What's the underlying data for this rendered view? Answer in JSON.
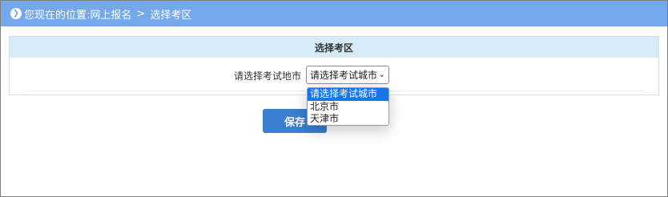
{
  "breadcrumb": {
    "icon": "chevron-right-circle-icon",
    "prefix": "您现在的位置:",
    "item1": "网上报名",
    "separator": ">",
    "item2": "选择考区"
  },
  "panel": {
    "title": "选择考区"
  },
  "form": {
    "city_label": "请选择考试地市",
    "city_select_value": "请选择考试城市",
    "options": [
      "请选择考试城市",
      "北京市",
      "天津市"
    ],
    "selected_index": 0
  },
  "actions": {
    "save_label": "保存"
  },
  "colors": {
    "topbar": "#74a8ea",
    "panel_header": "#d6ebf6",
    "button": "#3b7fd1",
    "option_highlight": "#1a73e8"
  }
}
